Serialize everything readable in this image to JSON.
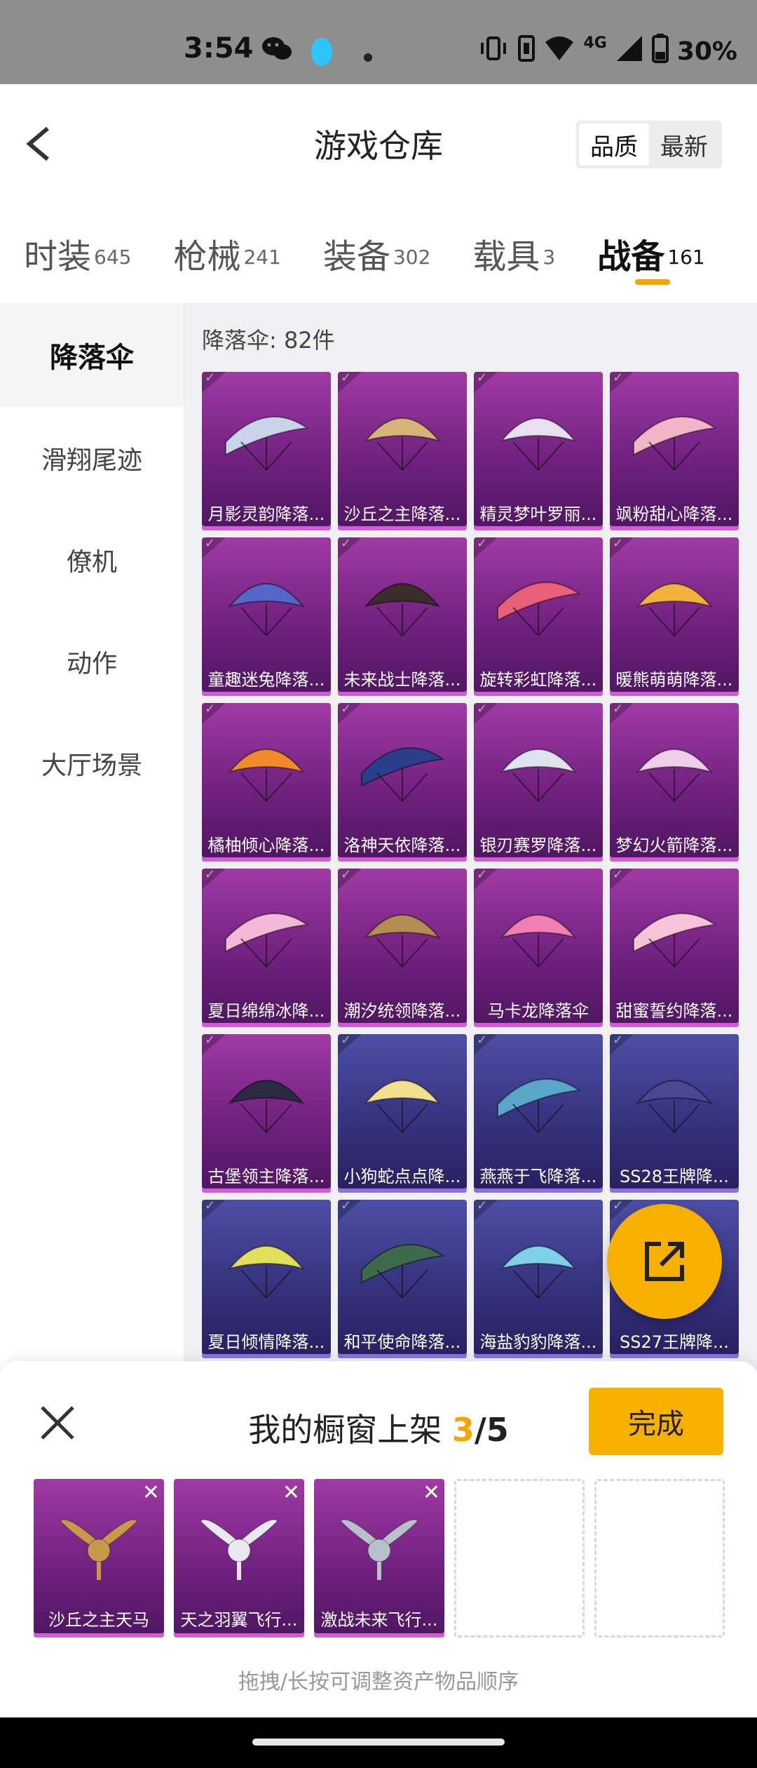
{
  "status": {
    "time": "3:54",
    "network": "4G",
    "battery": "30%"
  },
  "header": {
    "title": "游戏仓库",
    "sort_options": [
      "品质",
      "最新"
    ],
    "sort_active": "品质"
  },
  "category_tabs": [
    {
      "label": "时装",
      "count": "645"
    },
    {
      "label": "枪械",
      "count": "241"
    },
    {
      "label": "装备",
      "count": "302"
    },
    {
      "label": "载具",
      "count": "3"
    },
    {
      "label": "战备",
      "count": "161",
      "active": true
    }
  ],
  "sidebar": {
    "items": [
      "降落伞",
      "滑翔尾迹",
      "僚机",
      "动作",
      "大厅场景"
    ],
    "active": "降落伞"
  },
  "content": {
    "count_label": "降落伞: 82件",
    "items": [
      {
        "name": "月影灵韵降落...",
        "tier": "purple",
        "color": "#c9d4ea"
      },
      {
        "name": "沙丘之主降落...",
        "tier": "purple",
        "color": "#d8b478"
      },
      {
        "name": "精灵梦叶罗丽...",
        "tier": "purple",
        "color": "#e8e0ee"
      },
      {
        "name": "飒粉甜心降落...",
        "tier": "purple",
        "color": "#f2b6c8"
      },
      {
        "name": "童趣迷兔降落...",
        "tier": "purple",
        "color": "#5566c8"
      },
      {
        "name": "未来战士降落...",
        "tier": "purple",
        "color": "#3a2e2a"
      },
      {
        "name": "旋转彩虹降落...",
        "tier": "purple",
        "color": "#e9607a"
      },
      {
        "name": "暖熊萌萌降落...",
        "tier": "purple",
        "color": "#f0b23a"
      },
      {
        "name": "橘柚倾心降落...",
        "tier": "purple",
        "color": "#f08a2a"
      },
      {
        "name": "洛神天依降落...",
        "tier": "purple",
        "color": "#2a3f8c"
      },
      {
        "name": "银刃赛罗降落...",
        "tier": "purple",
        "color": "#dde4ee"
      },
      {
        "name": "梦幻火箭降落...",
        "tier": "purple",
        "color": "#f0cde8"
      },
      {
        "name": "夏日绵绵冰降...",
        "tier": "purple",
        "color": "#f3b9d6"
      },
      {
        "name": "潮汐统领降落...",
        "tier": "purple",
        "color": "#b58c52"
      },
      {
        "name": "马卡龙降落伞",
        "tier": "purple",
        "color": "#f17fb4"
      },
      {
        "name": "甜蜜誓约降落...",
        "tier": "purple",
        "color": "#f6c4d6"
      },
      {
        "name": "古堡领主降落...",
        "tier": "purple",
        "color": "#2a2a44"
      },
      {
        "name": "小狗蛇点点降...",
        "tier": "blue",
        "color": "#f4df8c"
      },
      {
        "name": "燕燕于飞降落...",
        "tier": "blue",
        "color": "#5aa6c8"
      },
      {
        "name": "SS28王牌降...",
        "tier": "blue",
        "color": "#4a4890"
      },
      {
        "name": "夏日倾情降落...",
        "tier": "blue",
        "color": "#e2e05a"
      },
      {
        "name": "和平使命降落...",
        "tier": "blue",
        "color": "#3d6a4a"
      },
      {
        "name": "海盐豹豹降落...",
        "tier": "blue",
        "color": "#7fd0e8"
      },
      {
        "name": "SS27王牌降...",
        "tier": "blue",
        "color": "#8a8ab0"
      }
    ]
  },
  "fab": {
    "icon": "share-icon"
  },
  "sheet": {
    "title_prefix": "我的橱窗上架 ",
    "current": "3",
    "total": "/5",
    "done_label": "完成",
    "slots": [
      {
        "name": "沙丘之主天马",
        "color": "#c79a4a"
      },
      {
        "name": "天之羽翼飞行...",
        "color": "#e8e8ee"
      },
      {
        "name": "激战未来飞行...",
        "color": "#b8c0cc"
      }
    ],
    "hint": "拖拽/长按可调整资产物品顺序"
  },
  "colors": {
    "accent": "#f8b000",
    "purple_card": "#8a2e92",
    "blue_card": "#34307a"
  }
}
